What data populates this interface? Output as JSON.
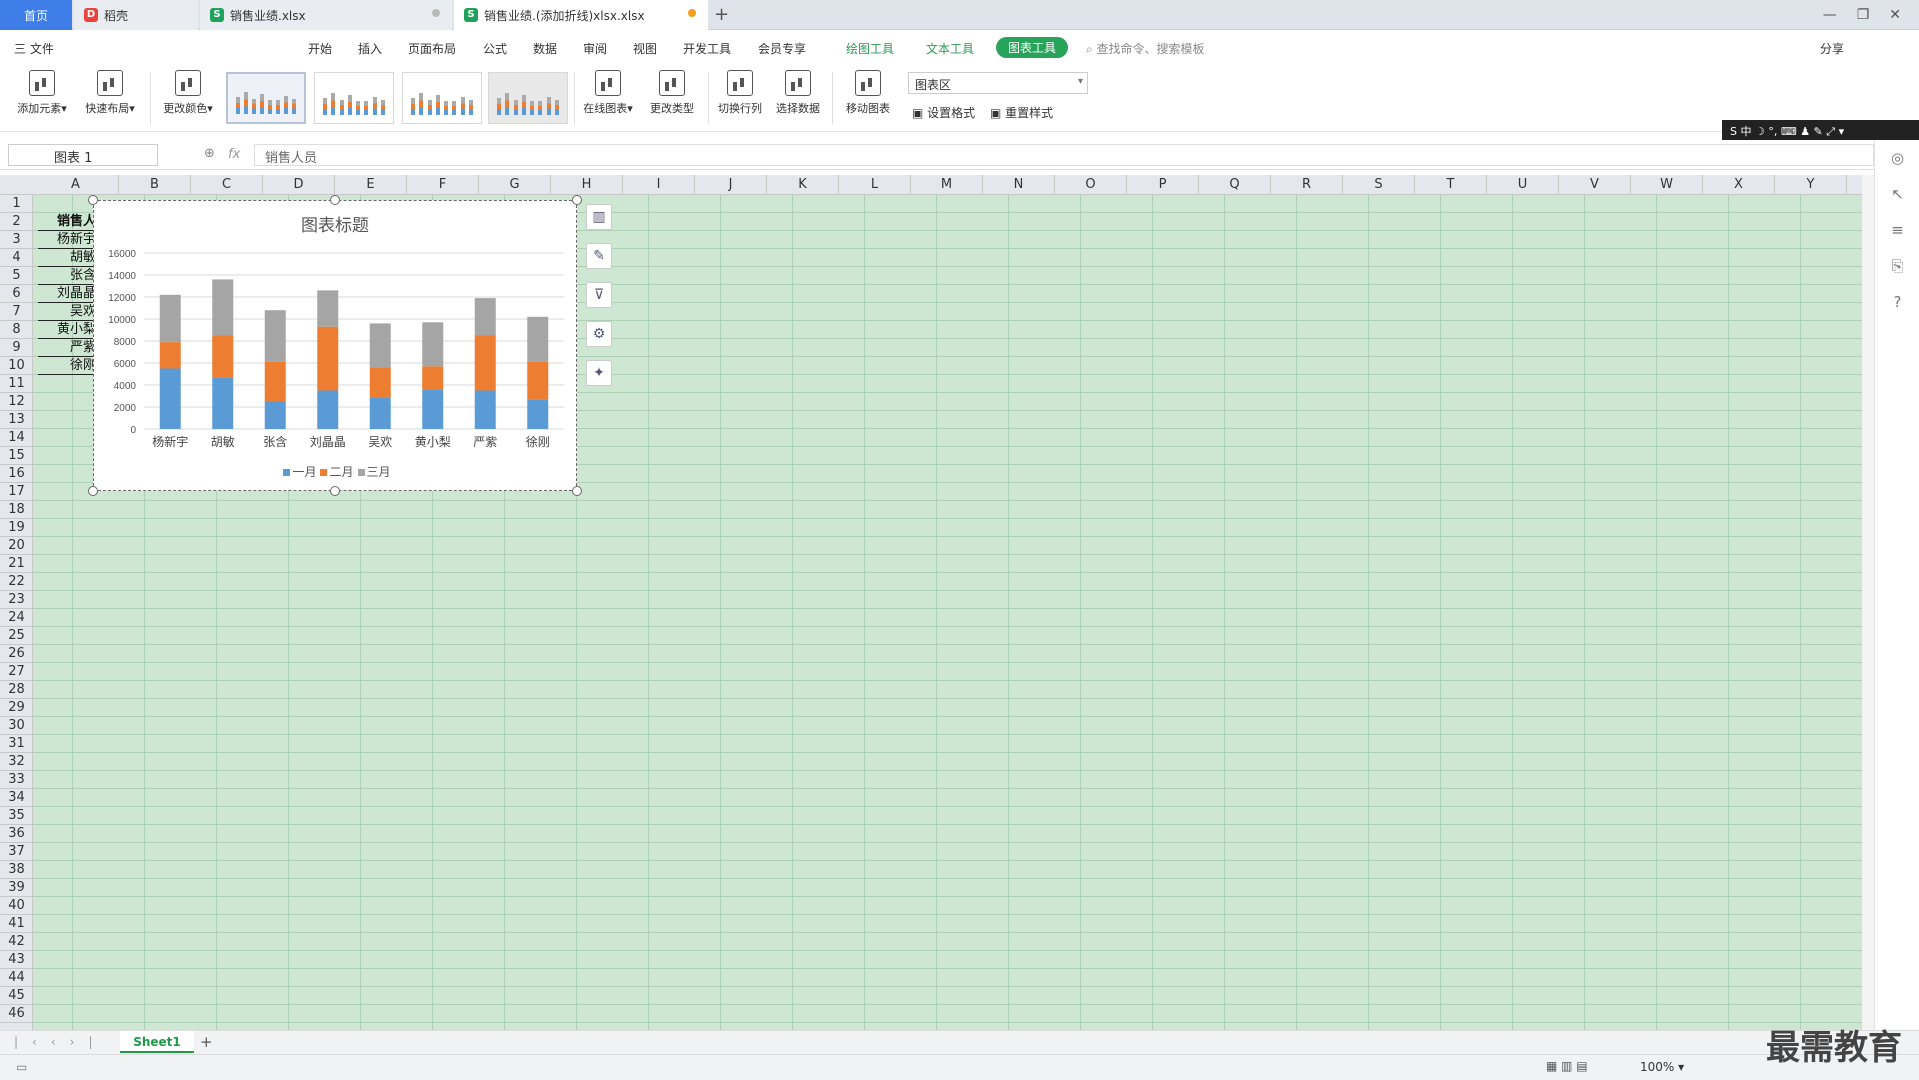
{
  "tabs": {
    "home": "首页",
    "daoke": "稻壳",
    "file1": "销售业绩.xlsx",
    "file2": "销售业绩.(添加折线)xlsx.xlsx",
    "add": "+"
  },
  "window": {
    "minimize": "—",
    "restore": "❐",
    "close": "✕"
  },
  "menu": {
    "file": "三 文件",
    "start": "开始",
    "insert": "插入",
    "page_layout": "页面布局",
    "formula": "公式",
    "data": "数据",
    "review": "审阅",
    "view": "视图",
    "developer": "开发工具",
    "member": "会员专享",
    "draw_tools": "绘图工具",
    "text_tools": "文本工具",
    "chart_tools": "图表工具",
    "search_placeholder": "查找命令、搜索模板",
    "share": "分享"
  },
  "ribbon": {
    "add_element": "添加元素▾",
    "quick_layout": "快速布局▾",
    "change_color": "更改颜色▾",
    "online_chart": "在线图表▾",
    "change_type": "更改类型",
    "switch_row_col": "切换行列",
    "select_data": "选择数据",
    "move_chart": "移动图表",
    "area_select": "图表区",
    "set_format": "设置格式",
    "reset_style": "重置样式"
  },
  "ime": {
    "label": "S 中 ☽ °, ⌨ ♟ ✎ ⤢ ▾"
  },
  "formula": {
    "name_box": "图表 1",
    "fx": "fx",
    "content": "销售人员"
  },
  "columns": [
    "A",
    "B",
    "C",
    "D",
    "E",
    "F",
    "G",
    "H",
    "I",
    "J",
    "K",
    "L",
    "M",
    "N",
    "O",
    "P",
    "Q",
    "R",
    "S",
    "T",
    "U",
    "V",
    "W",
    "X",
    "Y"
  ],
  "rows": [
    "1",
    "2",
    "3",
    "4",
    "5",
    "6",
    "7",
    "8",
    "9",
    "10",
    "11",
    "12",
    "13",
    "14",
    "15",
    "16",
    "17",
    "18",
    "19",
    "20",
    "21",
    "22",
    "23",
    "24",
    "25",
    "26",
    "27",
    "28",
    "29",
    "30",
    "31",
    "32",
    "33",
    "34",
    "35",
    "36",
    "37",
    "38",
    "39",
    "40",
    "41",
    "42",
    "43",
    "44",
    "45",
    "46"
  ],
  "cells_a": [
    "销售人",
    "杨新宇",
    "胡敏",
    "张含",
    "刘晶晶",
    "吴欢",
    "黄小梨",
    "严紫",
    "徐刚"
  ],
  "sheet": {
    "name": "Sheet1",
    "add": "+"
  },
  "status": {
    "zoom": "100% ▾"
  },
  "watermark": "最需教育",
  "chart_data": {
    "type": "bar",
    "stacked": true,
    "title": "图表标题",
    "categories": [
      "杨新宇",
      "胡敏",
      "张含",
      "刘晶晶",
      "吴欢",
      "黄小梨",
      "严紫",
      "徐刚"
    ],
    "series": [
      {
        "name": "一月",
        "color": "#5b9bd5",
        "values": [
          5500,
          4700,
          2500,
          3500,
          2900,
          3600,
          3500,
          2700
        ]
      },
      {
        "name": "二月",
        "color": "#ed7d31",
        "values": [
          2400,
          3800,
          3600,
          5800,
          2700,
          2100,
          5000,
          3400
        ]
      },
      {
        "name": "三月",
        "color": "#a5a5a5",
        "values": [
          4300,
          5100,
          4700,
          3300,
          4000,
          4000,
          3400,
          4100
        ]
      }
    ],
    "ylim": [
      0,
      16000
    ],
    "yticks": [
      "0",
      "2000",
      "4000",
      "6000",
      "8000",
      "10000",
      "12000",
      "14000",
      "16000"
    ],
    "grid": true,
    "legend": "bottom"
  }
}
